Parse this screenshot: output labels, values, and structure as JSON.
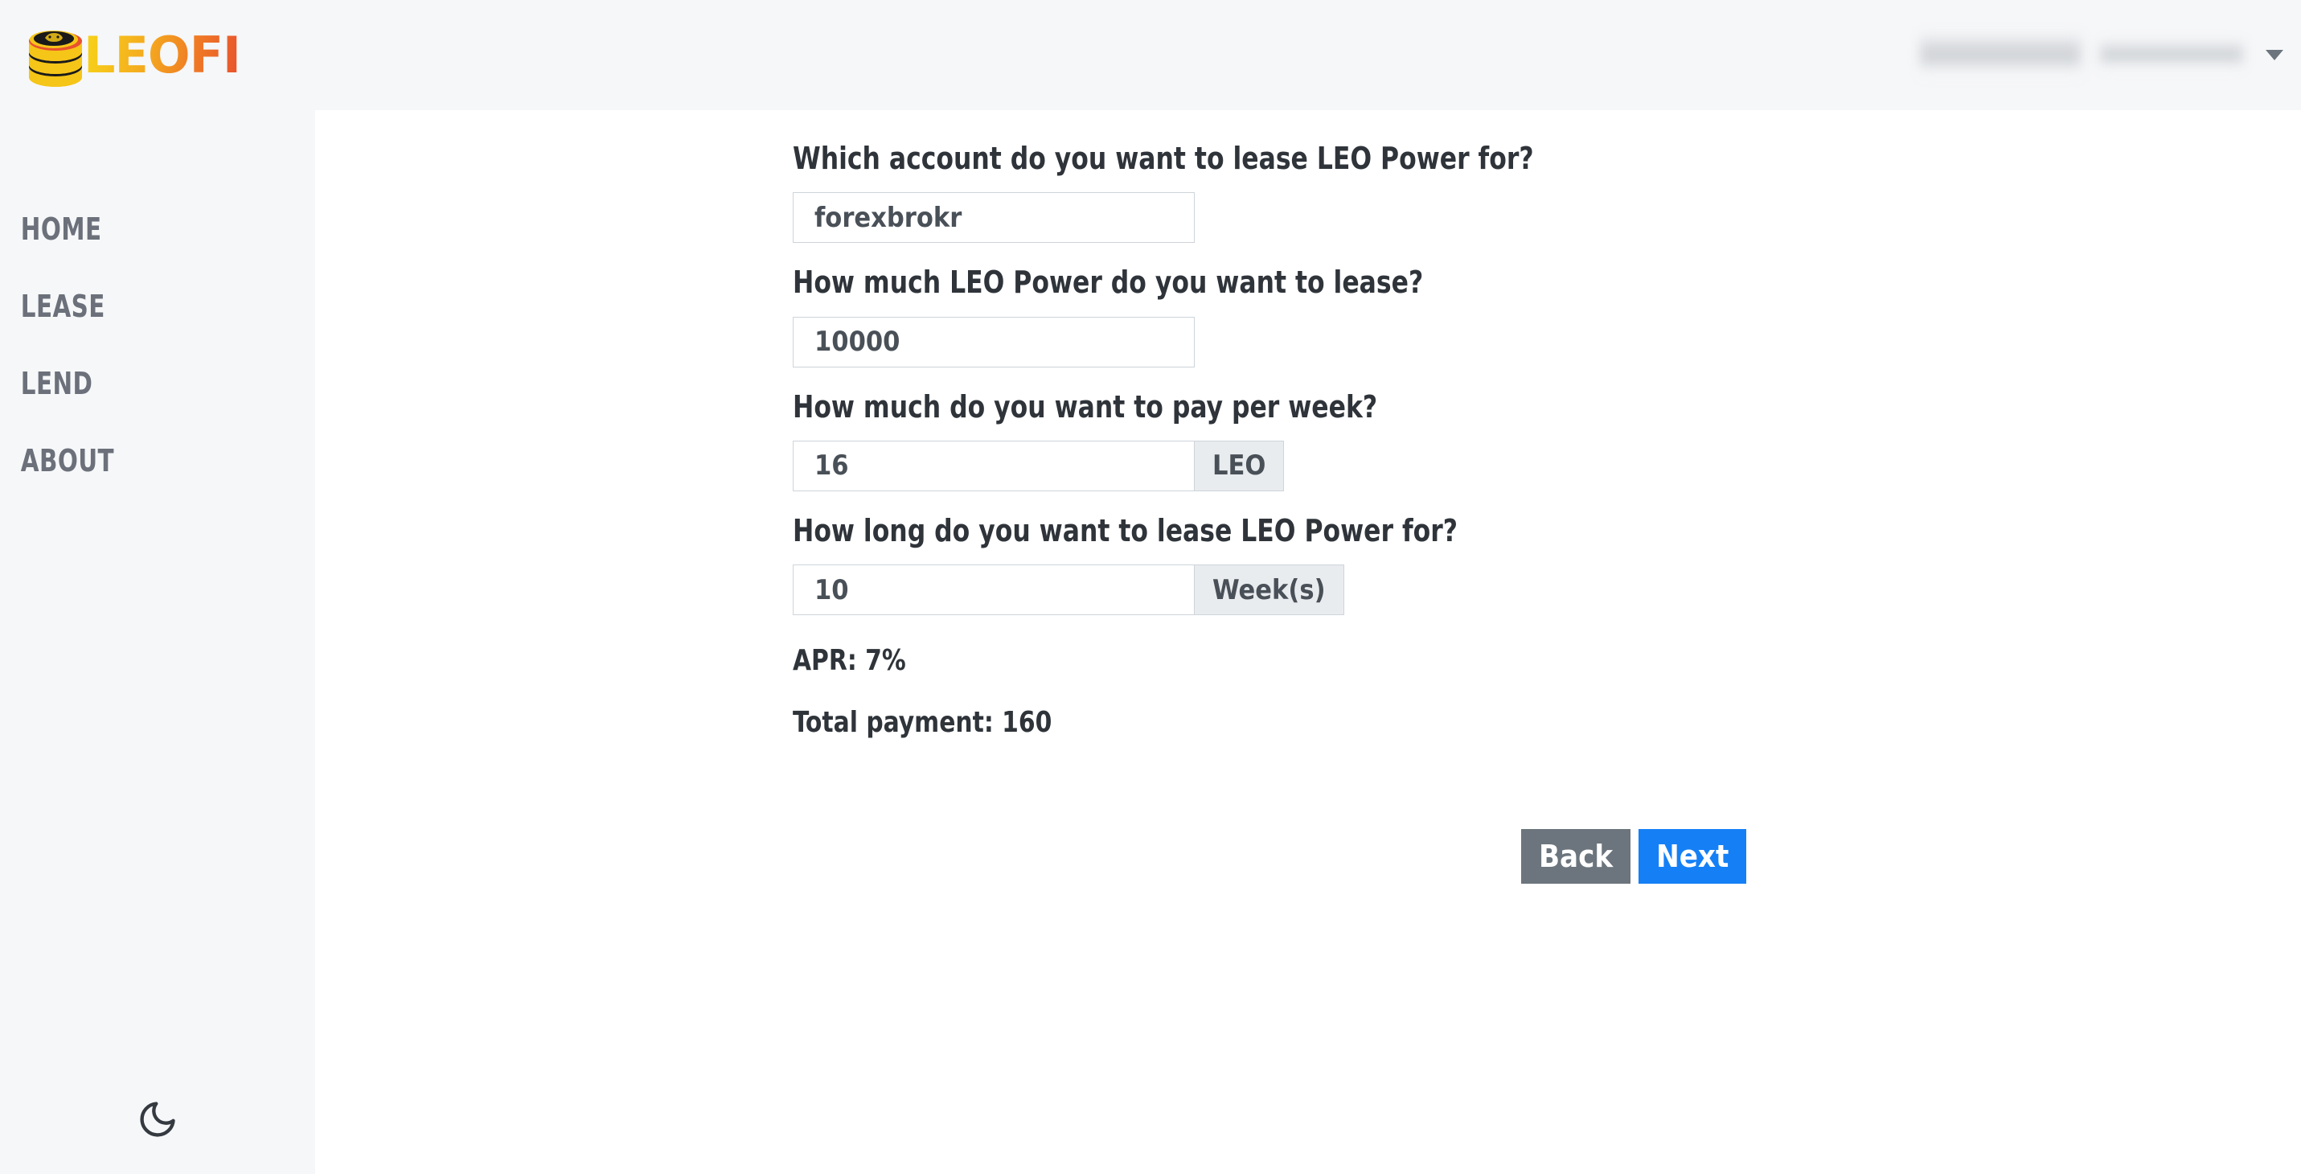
{
  "header": {
    "brand_name": "LEOFI",
    "logo_icon": "leo-coin-stack-icon",
    "account_blurred_1": "",
    "account_blurred_2": "",
    "caret_icon": "chevron-down-icon"
  },
  "sidebar": {
    "items": [
      {
        "label": "HOME"
      },
      {
        "label": "LEASE"
      },
      {
        "label": "LEND"
      },
      {
        "label": "ABOUT"
      }
    ],
    "theme_toggle_icon": "moon-icon"
  },
  "form": {
    "fields": [
      {
        "label": "Which account do you want to lease LEO Power for?",
        "value": "forexbrokr",
        "placeholder": "",
        "addon": ""
      },
      {
        "label": "How much LEO Power do you want to lease?",
        "value": "10000",
        "placeholder": "",
        "addon": ""
      },
      {
        "label": "How much do you want to pay per week?",
        "value": "16",
        "placeholder": "",
        "addon": "LEO"
      },
      {
        "label": "How long do you want to lease LEO Power for?",
        "value": "10",
        "placeholder": "",
        "addon": "Week(s)"
      }
    ],
    "apr_text": "APR: 7%",
    "total_payment_text": "Total payment: 160",
    "back_label": "Back",
    "next_label": "Next"
  },
  "colors": {
    "next_button": "#1580f5",
    "back_button": "#6c757d",
    "sidebar_bg": "#f6f7f9",
    "addon_bg": "#e9ecef",
    "input_border": "#ced4da",
    "brand_gradient_start": "#f7d417",
    "brand_gradient_end": "#e8512e"
  }
}
